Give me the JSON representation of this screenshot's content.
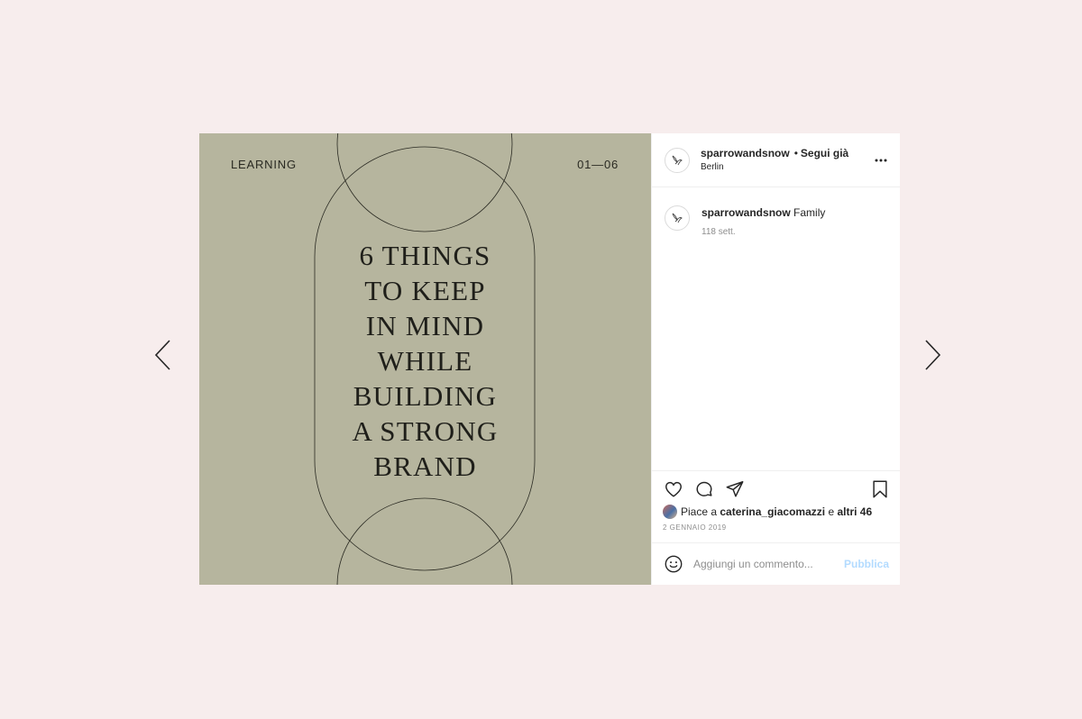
{
  "media": {
    "corner_left": "LEARNING",
    "corner_right": "01—06",
    "headline_lines": [
      "6 THINGS",
      "TO KEEP",
      "IN MIND",
      "WHILE",
      "BUILDING",
      "A STRONG",
      "BRAND"
    ],
    "background_color": "#b6b59e"
  },
  "header": {
    "username": "sparrowandsnow",
    "separator": "•",
    "follow_status": "Segui già",
    "location": "Berlin",
    "avatar_icon": "sparrow-icon",
    "more_icon": "more-options-icon"
  },
  "caption": {
    "username": "sparrowandsnow",
    "text": "Family",
    "time": "118 sett."
  },
  "actions": {
    "icons": [
      "heart-icon",
      "comment-icon",
      "share-icon",
      "bookmark-icon"
    ],
    "likes_prefix": "Piace a",
    "likes_user": "caterina_giacomazzi",
    "likes_middle": "e",
    "likes_others": "altri 46",
    "date": "2 GENNAIO 2019"
  },
  "comment": {
    "placeholder": "Aggiungi un commento...",
    "publish_label": "Pubblica"
  },
  "nav": {
    "prev_icon": "chevron-left-icon",
    "next_icon": "chevron-right-icon"
  },
  "colors": {
    "page_background": "#f7eded",
    "publish_disabled": "#b3dbff"
  }
}
